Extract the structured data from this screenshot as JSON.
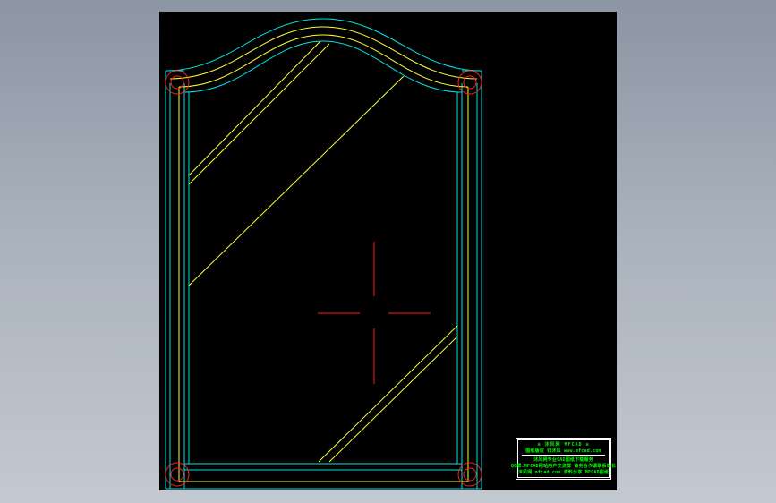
{
  "title_block": {
    "line1": "≡ 沐风网 MFCAD ≡",
    "line2": "图纸版权 归沐风   www.mfcad.com",
    "line3": "沐风网专业CAD图纸下载服务",
    "line4": "QQ群:MFCAD网站用户交流群 商务合作请联系站长",
    "line5": "沐风网 mfcad.com 资料分享 MFCAD图纸"
  },
  "colors": {
    "background": "#000000",
    "outline": "#00e5e5",
    "glass": "#ffff33",
    "crosshair": "#ff1a1a",
    "hinge": "#ff2020",
    "title_text": "#00ff00",
    "title_border": "#ffffff"
  }
}
